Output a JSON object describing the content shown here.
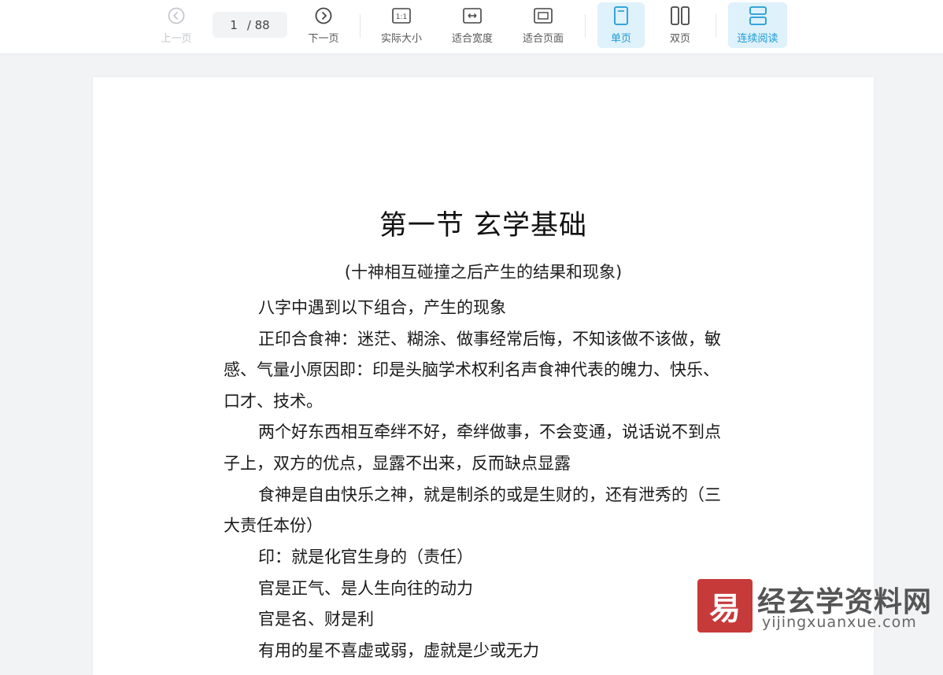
{
  "toolbar": {
    "prev_label": "上一页",
    "page_current": "1",
    "page_total": "/ 88",
    "next_label": "下一页",
    "actual_size_label": "实际大小",
    "actual_size_icon_text": "1:1",
    "fit_width_label": "适合宽度",
    "fit_page_label": "适合页面",
    "single_page_label": "单页",
    "double_page_label": "双页",
    "continuous_label": "连续阅读",
    "accent_color": "#1e9bd7",
    "active_bg": "#dff1fb"
  },
  "document": {
    "title": "第一节  玄学基础",
    "subtitle": "(十神相互碰撞之后产生的结果和现象)",
    "lines": [
      "八字中遇到以下组合，产生的现象",
      "正印合食神：迷茫、糊涂、做事经常后悔，不知该做不该做，敏",
      "感、气量小原因即：印是头脑学术权利名声食神代表的魄力、快乐、",
      "口才、技术。",
      "两个好东西相互牵绊不好，牵绊做事，不会变通，说话说不到点",
      "子上，双方的优点，显露不出来，反而缺点显露",
      "食神是自由快乐之神，就是制杀的或是生财的，还有泄秀的（三",
      "大责任本份）",
      "印：就是化官生身的（责任）",
      "官是正气、是人生向往的动力",
      "官是名、财是利",
      "有用的星不喜虚或弱，虚就是少或无力"
    ]
  },
  "watermark": {
    "logo_char": "易",
    "name": "经玄学资料网",
    "url": "yijingxuanxue.com",
    "logo_color": "#c73a3a"
  }
}
